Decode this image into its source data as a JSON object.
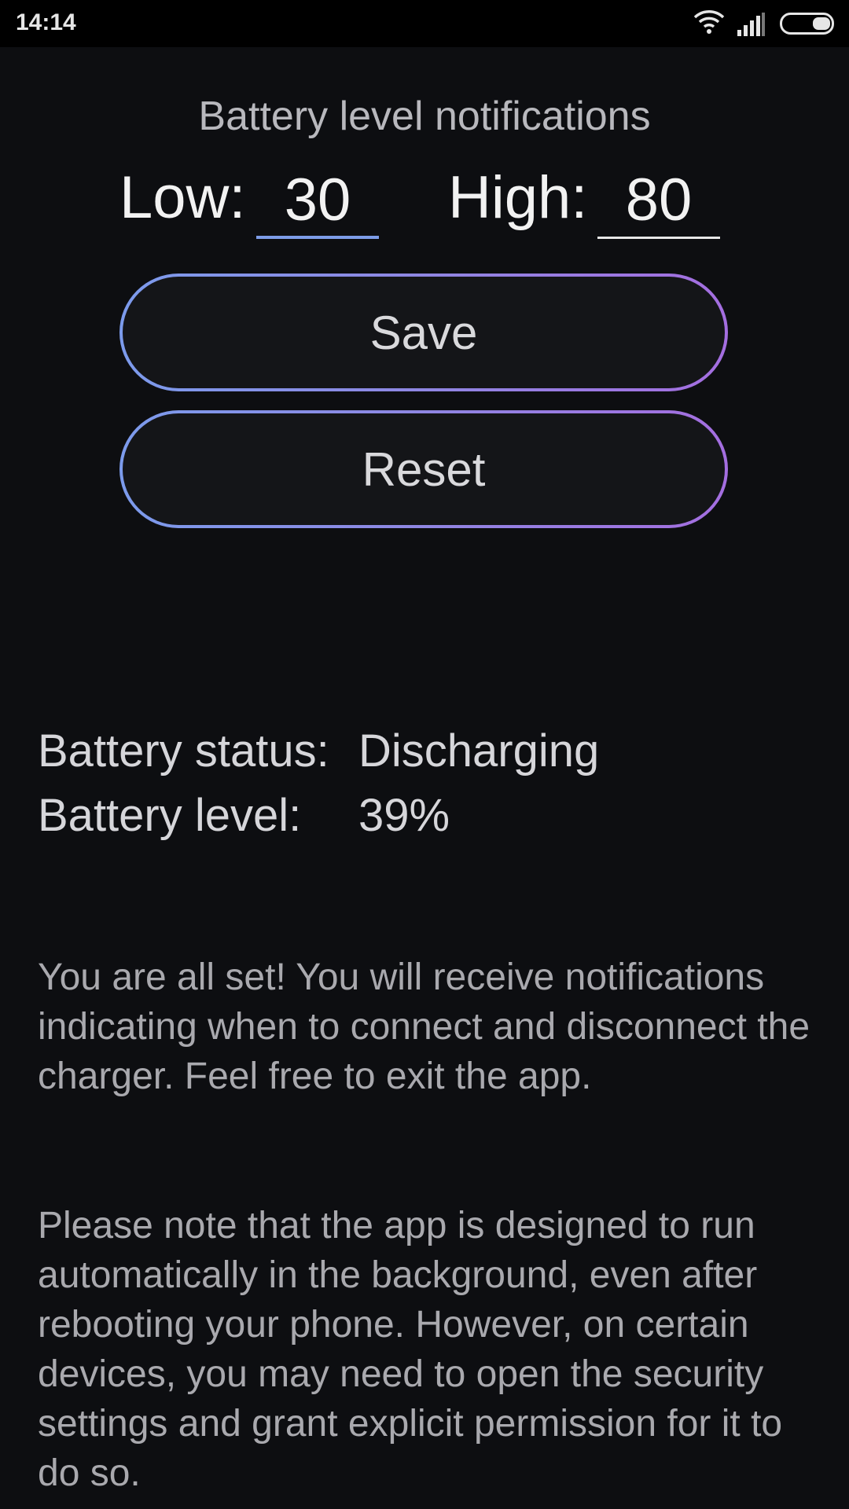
{
  "status_bar": {
    "time": "14:14",
    "icons": [
      "wifi-icon",
      "signal-icon",
      "battery-icon"
    ]
  },
  "notifications": {
    "title": "Battery level notifications",
    "low_label": "Low:",
    "low_value": "30",
    "high_label": "High:",
    "high_value": "80"
  },
  "buttons": {
    "save": "Save",
    "reset": "Reset"
  },
  "battery": {
    "status_label": "Battery status:",
    "status_value": "Discharging",
    "level_label": "Battery level:",
    "level_value": "39%"
  },
  "info": {
    "paragraph1": "You are all set! You will receive notifications indicating when to connect and disconnect the charger. Feel free to exit the app.",
    "paragraph2": "Please note that the app is designed to run automatically in the background, even after rebooting your phone. However, on certain devices, you may need to open the security settings and grant explicit permission for it to do so."
  },
  "colors": {
    "background": "#0d0e11",
    "gradient_start": "#7c9bec",
    "gradient_end": "#a46ee0",
    "focus_underline": "#7d9ce8"
  }
}
